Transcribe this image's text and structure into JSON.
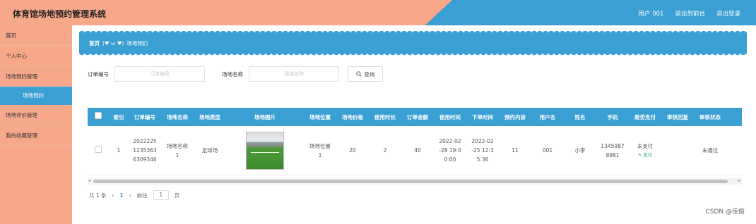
{
  "header": {
    "title": "体育馆场地预约管理系统",
    "user": "用户 001",
    "back_front": "退出到前台",
    "logout": "退出登录"
  },
  "sidebar": {
    "items": [
      {
        "label": "首页"
      },
      {
        "label": "个人中心",
        "chevron": "chevron-down-icon"
      },
      {
        "label": "场地预约管理",
        "chevron": "chevron-up-icon"
      },
      {
        "label": "场地评价管理",
        "chevron": "chevron-down-icon"
      },
      {
        "label": "我的收藏管理",
        "chevron": "chevron-down-icon"
      }
    ],
    "sub_item": "场地预约"
  },
  "breadcrumb": {
    "home": "首页",
    "emote": "(♥ ω ♥)",
    "current": "场地预约"
  },
  "search": {
    "order_label": "订单编号",
    "order_placeholder": "订单编号",
    "venue_label": "场地名称",
    "venue_placeholder": "场地名称",
    "button": "查询"
  },
  "table": {
    "headers": [
      "索引",
      "订单编号",
      "场地名称",
      "场地类型",
      "场地图片",
      "场地位置",
      "场地价格",
      "使用时长",
      "订单金额",
      "使用时间",
      "下单时间",
      "预约内容",
      "用户名",
      "姓名",
      "手机",
      "是否支付",
      "审核回复",
      "审核状态"
    ],
    "rows": [
      {
        "index": "1",
        "order_no": [
          "2022225",
          "1235363",
          "6309346"
        ],
        "venue_name": [
          "场地名称",
          "1"
        ],
        "venue_type": "足球场",
        "location": [
          "场地位置",
          "1"
        ],
        "price": "20",
        "duration": "2",
        "amount": "40",
        "use_time": [
          "2022-02",
          "-28 19:0",
          "0:00"
        ],
        "order_time": [
          "2022-02",
          "-25 12:3",
          "5:36"
        ],
        "content": "11",
        "username": "001",
        "name": "小李",
        "phone": [
          "1345987",
          "8981"
        ],
        "paid": "未支付",
        "pay_link": "支付",
        "reply": "",
        "status": "未通过"
      }
    ]
  },
  "pager": {
    "total": "共 1 条",
    "prev": "‹",
    "page": "1",
    "next": "›",
    "goto": "前往",
    "goto_value": "1",
    "page_unit": "页"
  },
  "watermark": "CSDN @佳偷"
}
